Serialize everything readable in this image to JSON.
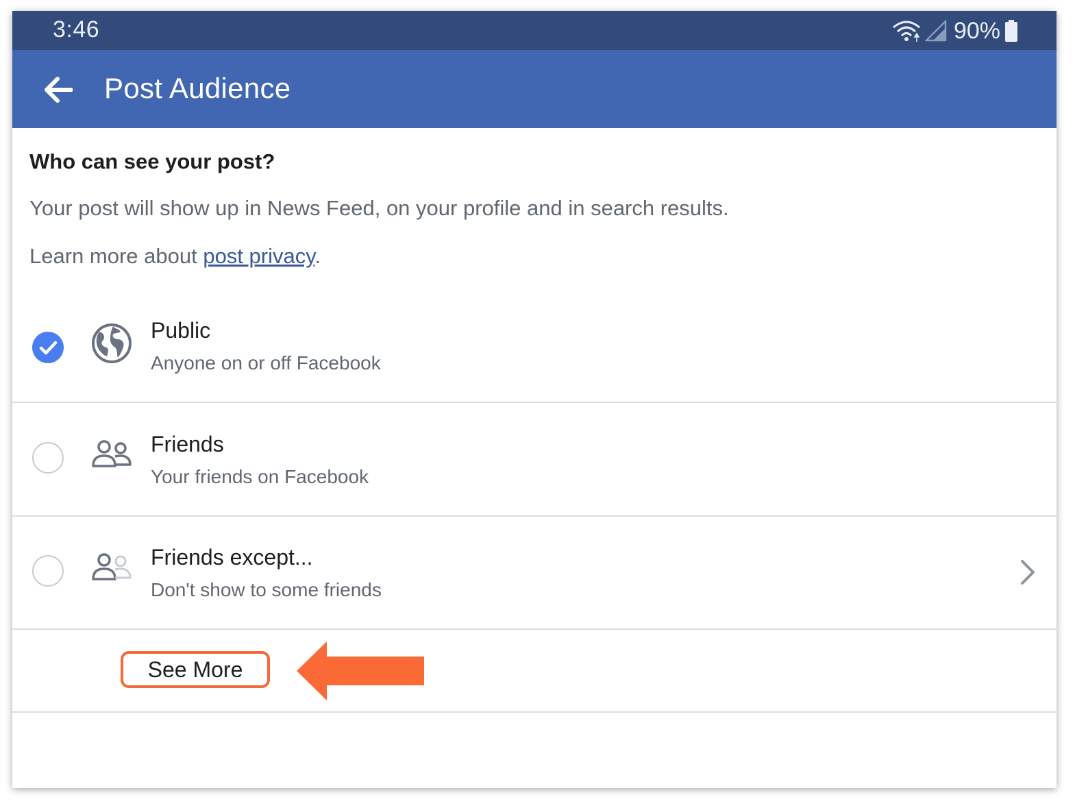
{
  "status_bar": {
    "time": "3:46",
    "battery": "90%",
    "icons": [
      "wifi-icon",
      "signal-icon",
      "battery-icon"
    ],
    "color": "#324b7a"
  },
  "app_bar": {
    "title": "Post Audience",
    "back_icon": "arrow-left-icon",
    "color": "#4267b2"
  },
  "intro": {
    "heading": "Who can see your post?",
    "description": "Your post will show up in News Feed, on your profile and in search results.",
    "learn_prefix": "Learn more about ",
    "learn_link": "post privacy",
    "learn_suffix": "."
  },
  "options": [
    {
      "title": "Public",
      "subtitle": "Anyone on or off Facebook",
      "icon": "globe-icon",
      "selected": true
    },
    {
      "title": "Friends",
      "subtitle": "Your friends on Facebook",
      "icon": "friends-icon",
      "selected": false
    },
    {
      "title": "Friends except...",
      "subtitle": "Don't show to some friends",
      "icon": "friends-except-icon",
      "selected": false,
      "has_chevron": true
    }
  ],
  "see_more": {
    "label": "See More",
    "highlight_color": "#f26a3a",
    "annotation_icon": "arrow-left-annotation-icon"
  },
  "colors": {
    "accent": "#4a7ef0",
    "link": "#385898"
  }
}
